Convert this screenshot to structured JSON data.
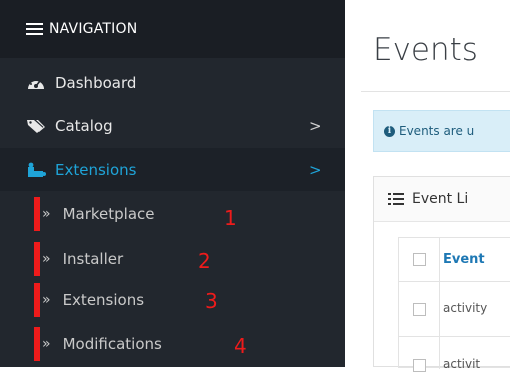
{
  "nav": {
    "header": "NAVIGATION",
    "items": [
      {
        "label": "Dashboard"
      },
      {
        "label": "Catalog",
        "chevron": ">"
      },
      {
        "label": "Extensions",
        "chevron": ">"
      }
    ],
    "subitems": [
      {
        "label": "Marketplace",
        "raquo": "»",
        "marker": "1"
      },
      {
        "label": "Installer",
        "raquo": "»",
        "marker": "2"
      },
      {
        "label": "Extensions",
        "raquo": "»",
        "marker": "3"
      },
      {
        "label": "Modifications",
        "raquo": "»",
        "marker": "4"
      }
    ]
  },
  "main": {
    "title": "Events",
    "alert": "Events are u",
    "panel_title": "Event Li",
    "table": {
      "header": "Event",
      "rows": [
        "activity",
        "activit"
      ]
    }
  },
  "colors": {
    "sidebar_bg": "#22272e",
    "header_bg": "#1a1e24",
    "active_color": "#1fa4d8",
    "annotation_red": "#ee1b1b",
    "alert_bg": "#d9eef8"
  },
  "icons": {
    "header": "hamburger-icon",
    "dashboard": "dashboard-icon",
    "catalog": "tag-icon",
    "extensions": "puzzle-icon",
    "alert": "info-circle-icon",
    "panel": "list-icon"
  }
}
